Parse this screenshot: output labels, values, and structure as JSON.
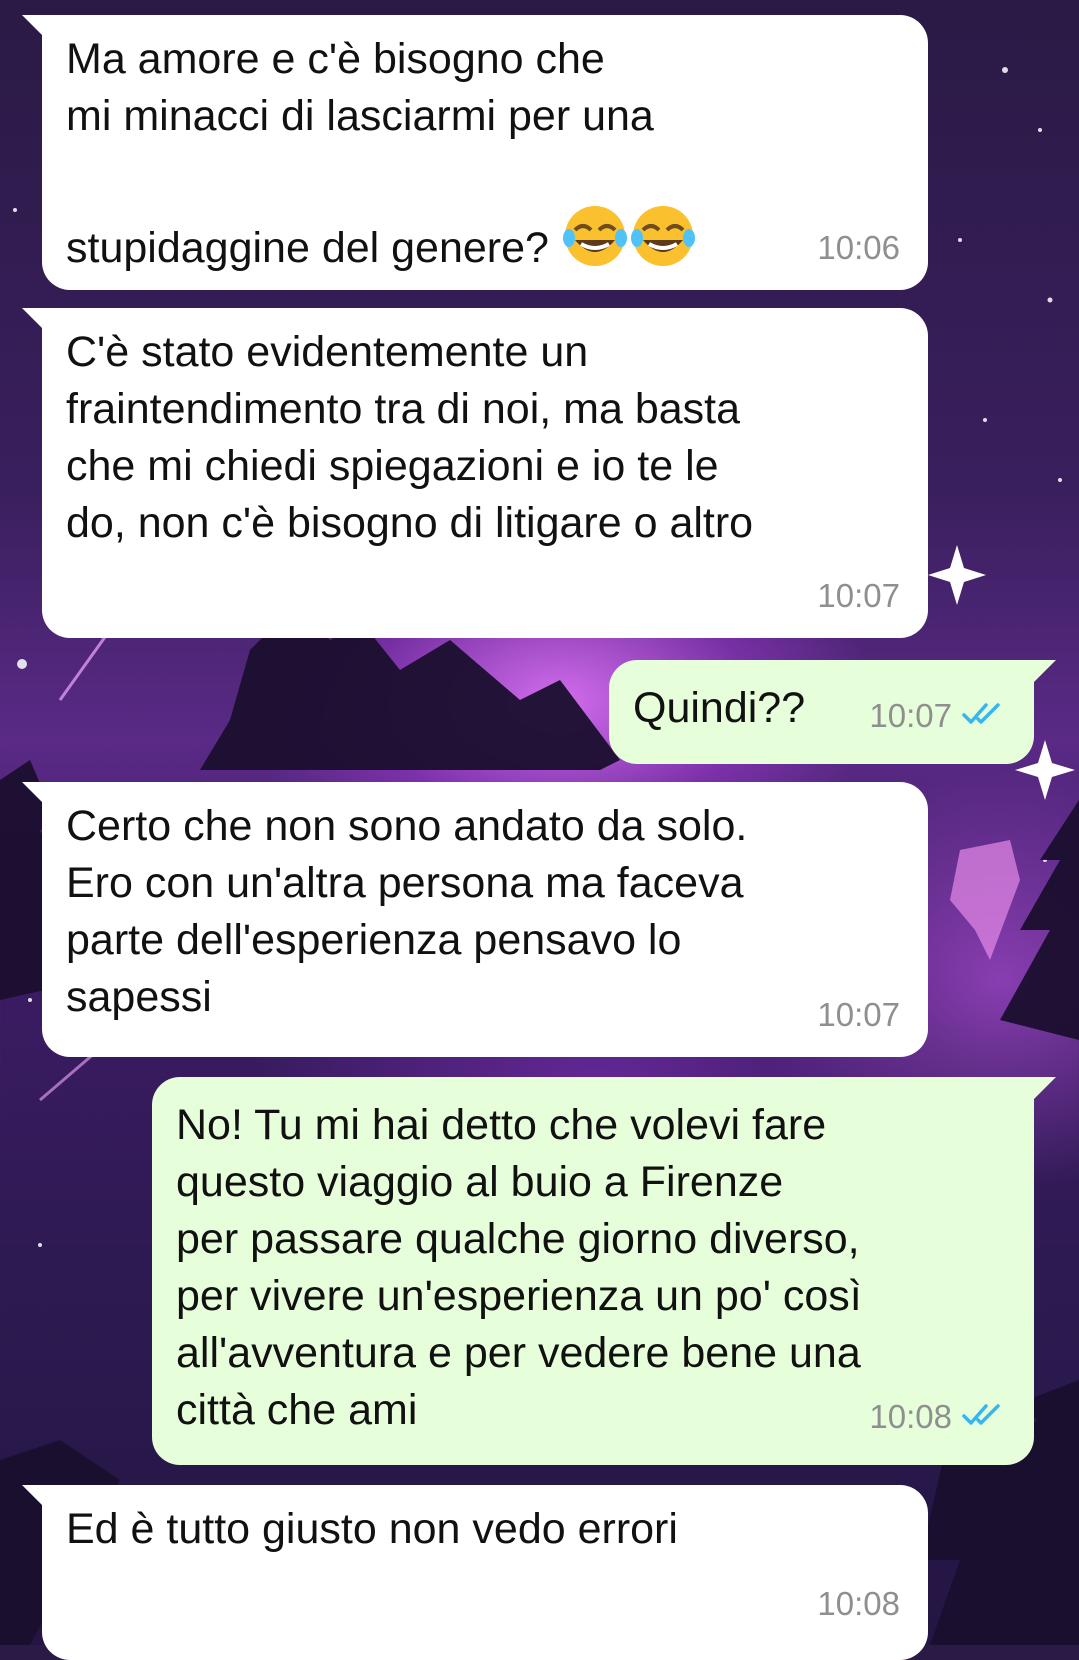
{
  "messages": [
    {
      "id": "m1",
      "direction": "incoming",
      "text": "Ma amore e c'è bisogno che\nmi minacci di lasciarmi per una\nstupidaggine del genere?",
      "emoji": "😂😂",
      "time": "10:06"
    },
    {
      "id": "m2",
      "direction": "incoming",
      "text": "C'è stato evidentemente un\nfraintendimento tra di noi, ma basta\nche mi chiedi spiegazioni e io te le\ndo, non c'è bisogno di litigare o altro",
      "time": "10:07"
    },
    {
      "id": "m3",
      "direction": "outgoing",
      "text": "Quindi??",
      "time": "10:07",
      "status": "read"
    },
    {
      "id": "m4",
      "direction": "incoming",
      "text": "Certo che non sono andato da solo.\nEro con un'altra persona ma faceva\nparte dell'esperienza pensavo lo\nsapessi",
      "time": "10:07"
    },
    {
      "id": "m5",
      "direction": "outgoing",
      "text": "No! Tu mi hai detto che volevi fare\nquesto viaggio al buio a Firenze\nper passare qualche giorno diverso,\nper vivere un'esperienza un po' così\nall'avventura e per vedere bene una\ncittà che ami",
      "time": "10:08",
      "status": "read"
    },
    {
      "id": "m6",
      "direction": "incoming",
      "text": "Ed è tutto giusto non vedo errori",
      "time": "10:08"
    }
  ],
  "colors": {
    "incoming_bubble": "#ffffff",
    "outgoing_bubble": "#e6ffda",
    "timestamp": "#8f8f8f",
    "read_check": "#34b7f1"
  },
  "icons": {
    "read_receipt": "double-check-icon",
    "laughing_emoji": "tears-of-joy-emoji"
  }
}
